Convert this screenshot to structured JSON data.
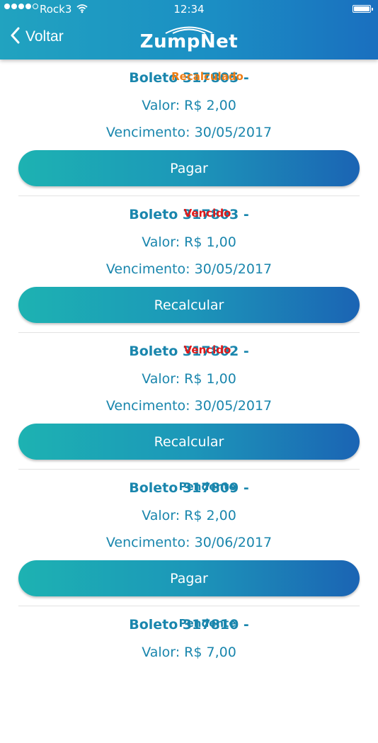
{
  "status_bar": {
    "carrier": "Rock3",
    "time": "12:34"
  },
  "nav": {
    "back_label": "Voltar",
    "logo_text": "ZumpNet"
  },
  "boletos": [
    {
      "title": "Boleto 317805",
      "separator": " - ",
      "status": "Recalculado",
      "status_color": "#ee7d14",
      "valor": "Valor: R$ 2,00",
      "vencimento": "Vencimento: 30/05/2017",
      "button": "Pagar"
    },
    {
      "title": "Boleto 317803",
      "separator": " - ",
      "status": "Vencido",
      "status_color": "#e01919",
      "valor": "Valor: R$ 1,00",
      "vencimento": "Vencimento: 30/05/2017",
      "button": "Recalcular"
    },
    {
      "title": "Boleto 317802",
      "separator": " - ",
      "status": "Vencido",
      "status_color": "#e01919",
      "valor": "Valor: R$ 1,00",
      "vencimento": "Vencimento: 30/05/2017",
      "button": "Recalcular"
    },
    {
      "title": "Boleto 317809",
      "separator": " - ",
      "status": "Pendente",
      "status_color": "#1a86ad",
      "valor": "Valor: R$ 2,00",
      "vencimento": "Vencimento: 30/06/2017",
      "button": "Pagar"
    },
    {
      "title": "Boleto 317810",
      "separator": " - ",
      "status": "Pendente",
      "status_color": "#1a86ad",
      "valor": "Valor: R$ 7,00",
      "vencimento": "",
      "button": ""
    }
  ],
  "colors": {
    "accent": "#1a86ad",
    "header_gradient_start": "#21a3c0",
    "header_gradient_end": "#1a6fbf"
  }
}
